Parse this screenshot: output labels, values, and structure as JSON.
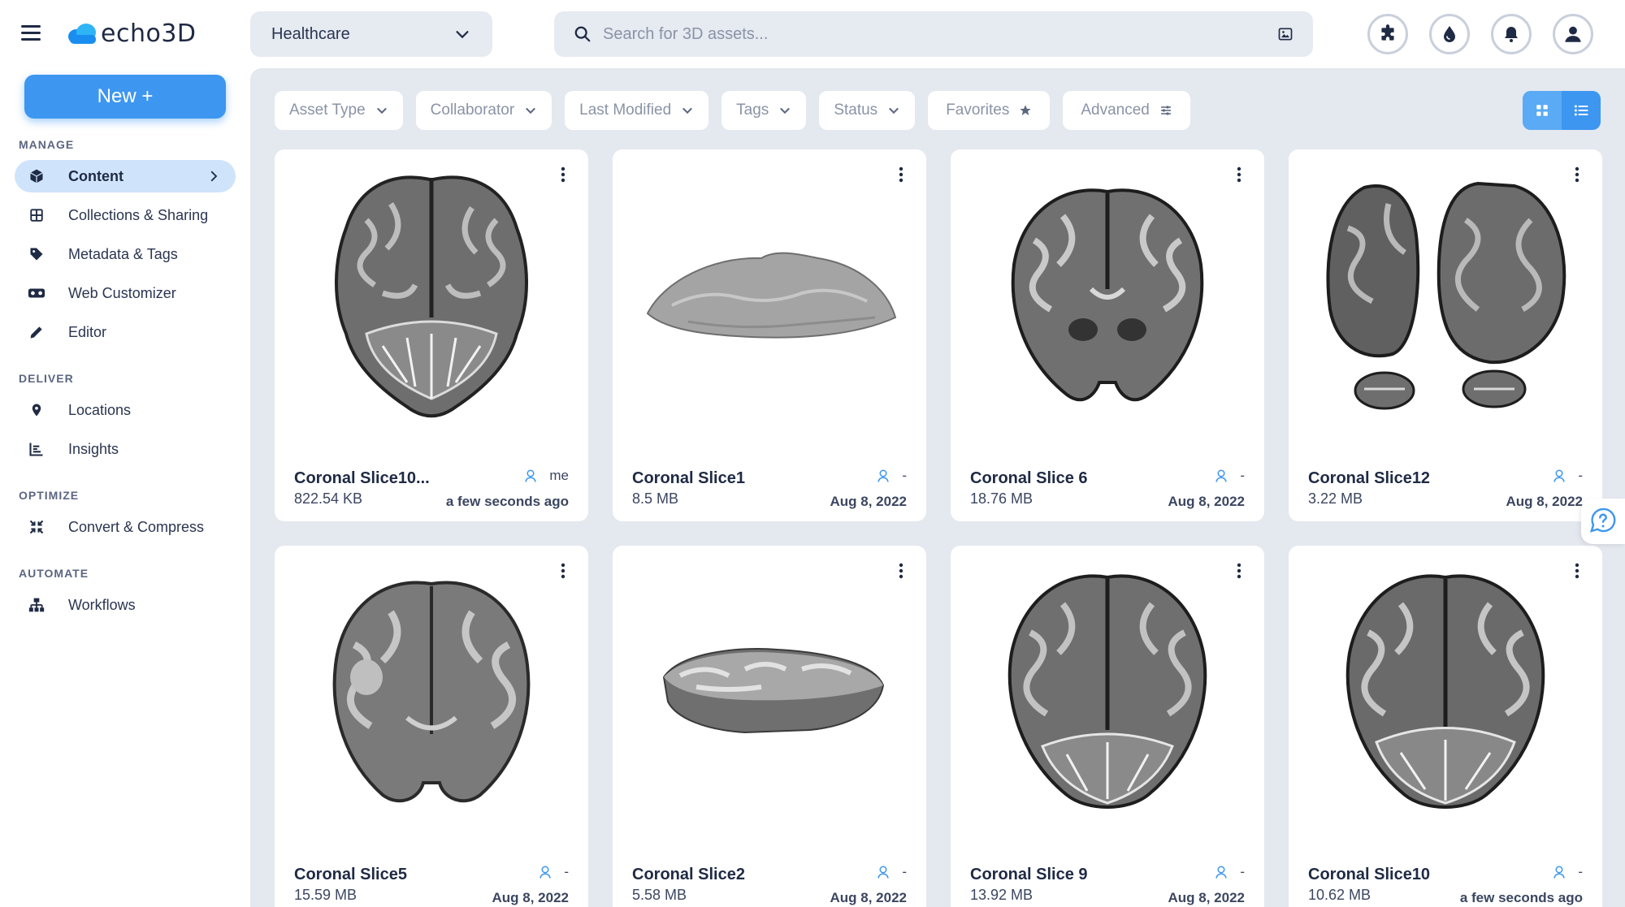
{
  "app": {
    "logo_text": "echo3D",
    "accent": "#3d96f0",
    "active_nav_bg": "#cfe4fa"
  },
  "header": {
    "project": "Healthcare",
    "search_placeholder": "Search for 3D assets...",
    "icons": [
      "puzzle-icon",
      "drop-icon",
      "bell-icon",
      "user-icon"
    ]
  },
  "sidebar": {
    "new_label": "New +",
    "sections": {
      "manage": "MANAGE",
      "deliver": "DELIVER",
      "optimize": "OPTIMIZE",
      "automate": "AUTOMATE"
    },
    "items": {
      "content": "Content",
      "collections": "Collections & Sharing",
      "metadata": "Metadata & Tags",
      "web_customizer": "Web Customizer",
      "editor": "Editor",
      "locations": "Locations",
      "insights": "Insights",
      "convert": "Convert & Compress",
      "workflows": "Workflows"
    }
  },
  "filters": {
    "asset_type": "Asset Type",
    "collaborator": "Collaborator",
    "last_modified": "Last Modified",
    "tags": "Tags",
    "status": "Status",
    "favorites": "Favorites",
    "advanced": "Advanced"
  },
  "assets": [
    {
      "name": "Coronal Slice10...",
      "size": "822.54 KB",
      "owner": "me",
      "date": "a few seconds ago"
    },
    {
      "name": "Coronal Slice1",
      "size": "8.5 MB",
      "owner": "-",
      "date": "Aug 8, 2022"
    },
    {
      "name": "Coronal Slice 6",
      "size": "18.76 MB",
      "owner": "-",
      "date": "Aug 8, 2022"
    },
    {
      "name": "Coronal Slice12",
      "size": "3.22 MB",
      "owner": "-",
      "date": "Aug 8, 2022"
    },
    {
      "name": "Coronal Slice5",
      "size": "15.59 MB",
      "owner": "-",
      "date": "Aug 8, 2022"
    },
    {
      "name": "Coronal Slice2",
      "size": "5.58 MB",
      "owner": "-",
      "date": "Aug 8, 2022"
    },
    {
      "name": "Coronal Slice 9",
      "size": "13.92 MB",
      "owner": "-",
      "date": "Aug 8, 2022"
    },
    {
      "name": "Coronal Slice10",
      "size": "10.62 MB",
      "owner": "-",
      "date": "a few seconds ago"
    }
  ]
}
